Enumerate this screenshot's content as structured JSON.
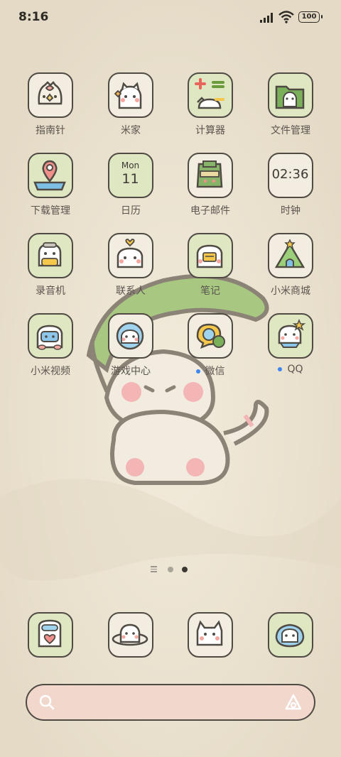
{
  "status": {
    "time": "8:16",
    "battery": "100"
  },
  "apps": [
    {
      "label": "指南针",
      "icon": "compass-cat-icon"
    },
    {
      "label": "米家",
      "icon": "home-cat-icon"
    },
    {
      "label": "计算器",
      "icon": "calculator-icon"
    },
    {
      "label": "文件管理",
      "icon": "folder-cat-icon"
    },
    {
      "label": "下载管理",
      "icon": "download-pin-icon"
    },
    {
      "label": "日历",
      "icon": "calendar-icon",
      "month": "Mon",
      "day": "11"
    },
    {
      "label": "电子邮件",
      "icon": "mail-icon"
    },
    {
      "label": "时钟",
      "icon": "clock-icon",
      "time": "02:36"
    },
    {
      "label": "录音机",
      "icon": "recorder-icon"
    },
    {
      "label": "联系人",
      "icon": "contacts-cat-icon"
    },
    {
      "label": "笔记",
      "icon": "notes-icon"
    },
    {
      "label": "小米商城",
      "icon": "store-icon"
    },
    {
      "label": "小米视频",
      "icon": "video-icon"
    },
    {
      "label": "游戏中心",
      "icon": "game-center-icon"
    },
    {
      "label": "微信",
      "icon": "wechat-icon",
      "badge": true
    },
    {
      "label": "QQ",
      "icon": "qq-icon",
      "badge": true
    }
  ],
  "dock": [
    {
      "icon": "phone-icon"
    },
    {
      "icon": "messages-cat-icon"
    },
    {
      "icon": "camera-cat-icon"
    },
    {
      "icon": "browser-cat-icon"
    }
  ],
  "page_indicator": {
    "pages": 2,
    "current": 2
  },
  "colors": {
    "background": "#ede5d3",
    "tile": "#f3ece0",
    "tile_green": "#dfe6c2",
    "outline": "#4f4a44",
    "search_bar": "#f2d7cc",
    "badge": "#3d86f5"
  }
}
